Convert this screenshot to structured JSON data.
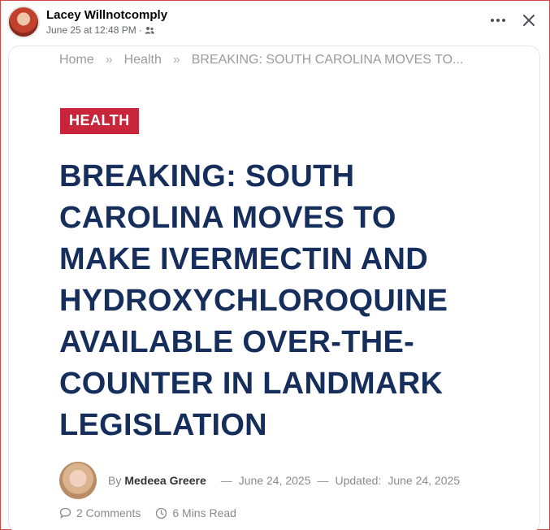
{
  "post": {
    "author_name": "Lacey Willnotcomply",
    "timestamp": "June 25 at 12:48 PM",
    "separator": "·"
  },
  "article": {
    "breadcrumb": [
      "Home",
      "Health",
      "BREAKING: SOUTH CAROLINA MOVES TO..."
    ],
    "breadcrumb_separator": "»",
    "category": "HEALTH",
    "headline_lines": [
      "BREAKING: SOUTH",
      "CAROLINA MOVES TO",
      "MAKE IVERMECTIN AND",
      "HYDROXYCHLOROQUINE",
      "AVAILABLE OVER-THE-",
      "COUNTER IN LANDMARK",
      "LEGISLATION"
    ],
    "byline": {
      "by": "By",
      "author": "Medeea Greere",
      "dash": "—",
      "published": "June 24, 2025",
      "updated_label": "Updated:",
      "updated": "June 24, 2025"
    },
    "comments": "2 Comments",
    "read_time": "6 Mins Read"
  },
  "colors": {
    "headline": "#162e5c",
    "badge": "#c8253b",
    "frame": "#d24545"
  }
}
